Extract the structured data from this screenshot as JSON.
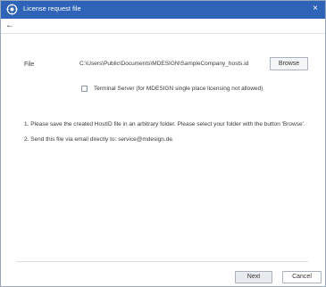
{
  "window": {
    "title": "License request file",
    "close_glyph": "×",
    "icon": "gear-icon",
    "accent_color": "#2f63b7"
  },
  "nav": {
    "back_glyph": "←"
  },
  "form": {
    "file_label": "File",
    "file_path": "C:\\Users\\Public\\Documents\\MDESIGN\\SampleCompany_hosts.id",
    "browse_label": "Browse",
    "terminal_server_label": "Terminal Server (for MDESIGN single place licensing not allowed)",
    "terminal_server_checked": false
  },
  "instructions": [
    "1. Please save the created HostID file in an arbitrary folder. Please select your folder with the button 'Browse'.",
    "2. Send this file via email directly to: service@mdesign.de."
  ],
  "footer": {
    "next_label": "Next",
    "cancel_label": "Cancel"
  }
}
